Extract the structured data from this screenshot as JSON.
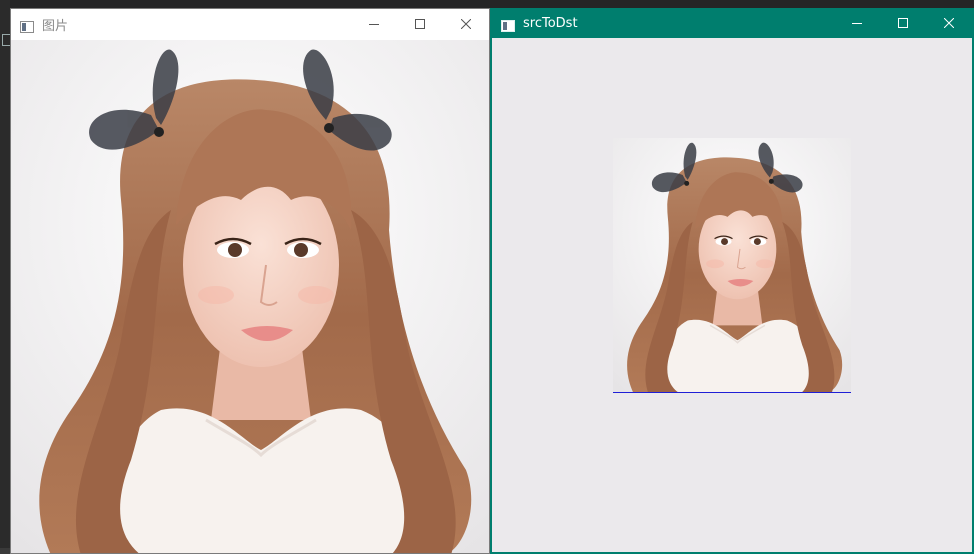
{
  "windows": {
    "picture": {
      "title": "图片",
      "controls": [
        "minimize",
        "maximize",
        "close"
      ]
    },
    "src_to_dst": {
      "title": "srcToDst",
      "controls": [
        "minimize",
        "maximize",
        "close"
      ]
    }
  },
  "colors": {
    "active_titlebar": "#007e6e",
    "inactive_titlebar": "#ffffff",
    "client_bg": "#ebe9ec",
    "hair": "#a8704e",
    "skin": "#f3d2c4"
  },
  "image": {
    "subject": "portrait-woman-long-hair"
  }
}
